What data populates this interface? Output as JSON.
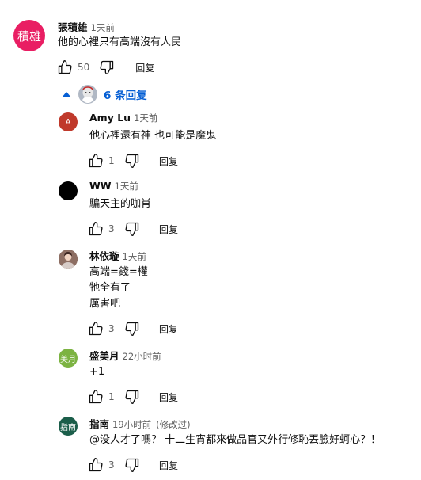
{
  "top_comment": {
    "avatar_text": "積雄",
    "avatar_color": "#e91e63",
    "author": "張積雄",
    "time": "1天前",
    "text": "他的心裡只有高端沒有人民",
    "likes": "50",
    "reply_label": "回复"
  },
  "replies_toggle": {
    "label": "6 条回复",
    "accent_color": "#065fd4"
  },
  "replies": [
    {
      "author": "Amy Lu",
      "time": "1天前",
      "edited": "",
      "avatar_text": "A",
      "avatar_color": "#c0392b",
      "text": "他心裡還有神 也可能是魔鬼",
      "likes": "1",
      "reply_label": "回复"
    },
    {
      "author": "WW",
      "time": "1天前",
      "edited": "",
      "avatar_text": "",
      "avatar_color": "#000000",
      "text": "騙天主的咖肖",
      "likes": "3",
      "reply_label": "回复"
    },
    {
      "author": "林依璇",
      "time": "1天前",
      "edited": "",
      "avatar_text": "",
      "avatar_color": "#7a5a52",
      "text": "高端=錢=權\n牠全有了\n厲害吧",
      "likes": "3",
      "reply_label": "回复"
    },
    {
      "author": "盛美月",
      "time": "22小时前",
      "edited": "",
      "avatar_text": "美月",
      "avatar_color": "#7cb342",
      "text": "+1",
      "likes": "1",
      "reply_label": "回复"
    },
    {
      "author": "指南",
      "time": "19小时前",
      "edited": "(修改过)",
      "avatar_text": "指南",
      "avatar_color": "#1b5e4a",
      "text": "@没人才了嗎？ 十二生宵都來做品官又外行修恥丟臉好蚵心？！",
      "likes": "3",
      "reply_label": "回复"
    }
  ]
}
